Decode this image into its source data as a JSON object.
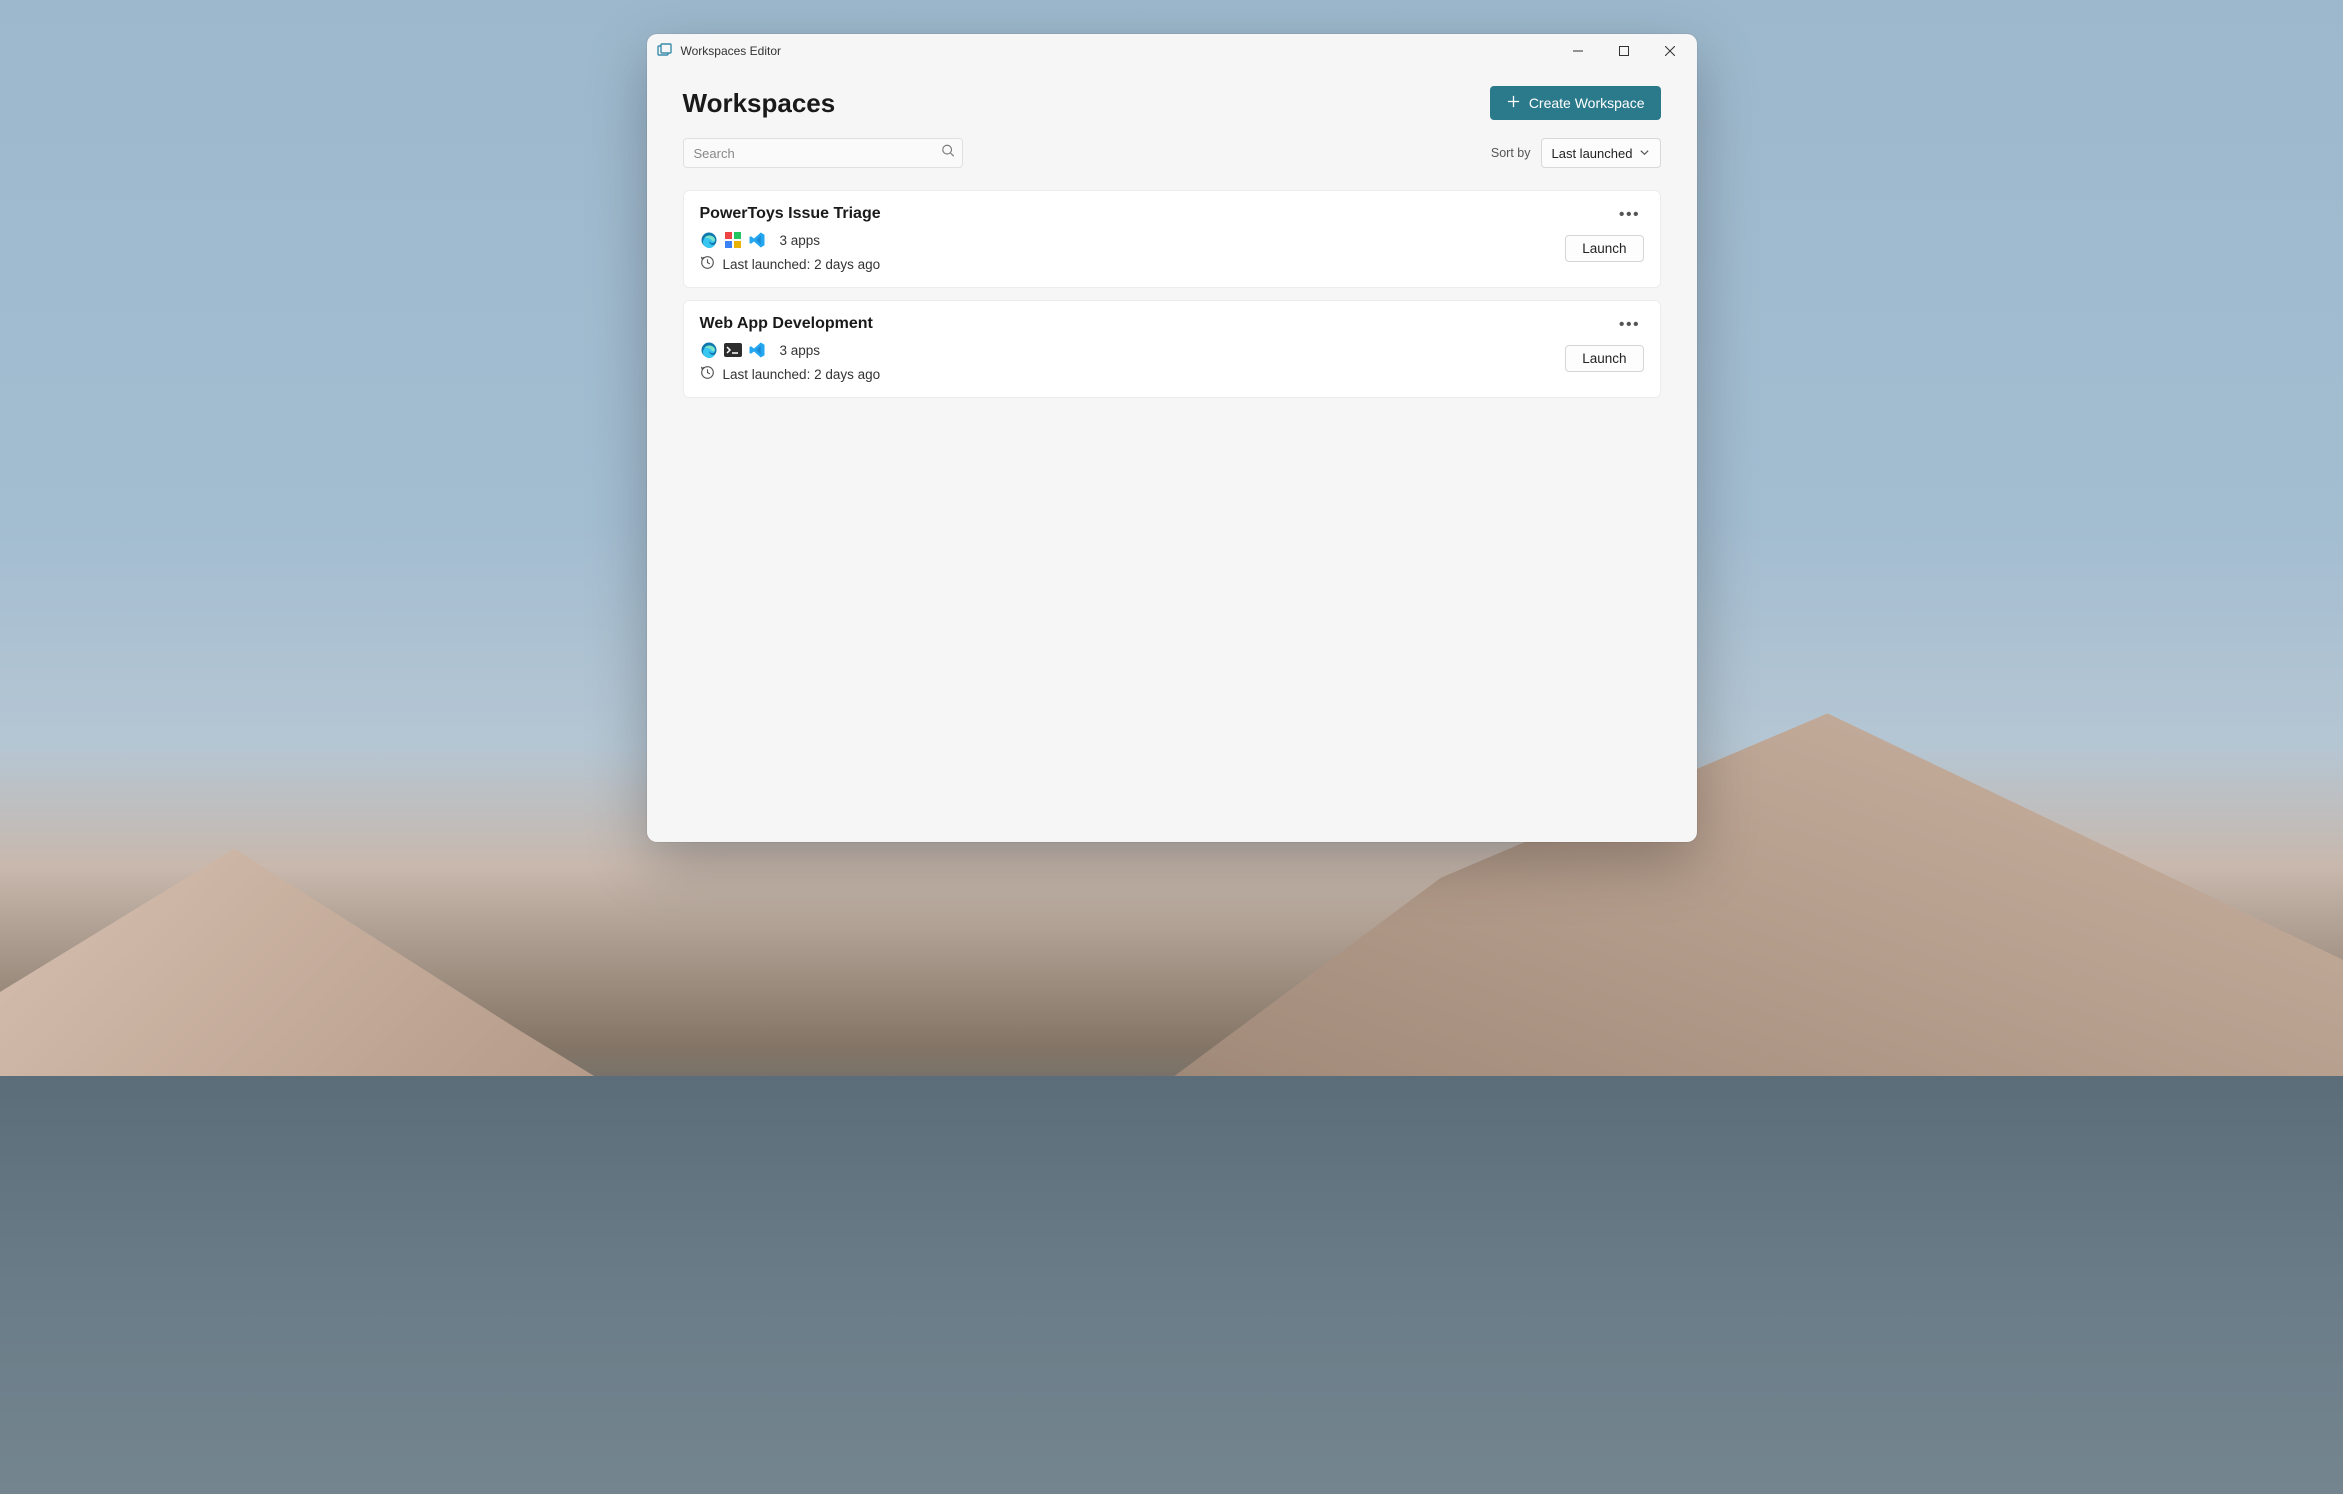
{
  "window": {
    "title": "Workspaces Editor"
  },
  "header": {
    "page_title": "Workspaces",
    "create_button": "Create Workspace"
  },
  "search": {
    "placeholder": "Search",
    "value": ""
  },
  "sort": {
    "label": "Sort by",
    "selected": "Last launched"
  },
  "accent_color": "#2b7a8c",
  "workspaces": [
    {
      "title": "PowerToys Issue Triage",
      "app_icons": [
        "edge-icon",
        "powertoys-icon",
        "vscode-icon"
      ],
      "apps_count": "3 apps",
      "last_launched": "Last launched: 2 days ago",
      "launch_label": "Launch"
    },
    {
      "title": "Web App Development",
      "app_icons": [
        "edge-icon",
        "terminal-icon",
        "vscode-icon"
      ],
      "apps_count": "3 apps",
      "last_launched": "Last launched: 2 days ago",
      "launch_label": "Launch"
    }
  ]
}
